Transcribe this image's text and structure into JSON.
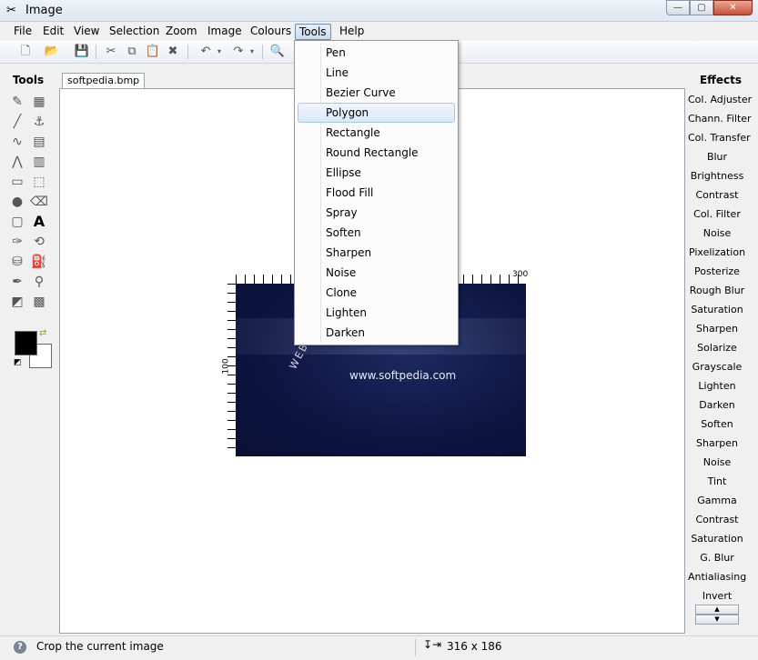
{
  "window": {
    "title": "Image",
    "min": "—",
    "max": "▢",
    "close": "✕"
  },
  "menu": [
    "File",
    "Edit",
    "View",
    "Selection",
    "Zoom",
    "Image",
    "Colours",
    "Tools",
    "Help"
  ],
  "tools_panel": {
    "title": "Tools"
  },
  "effects_panel": {
    "title": "Effects",
    "items": [
      "Col. Adjuster",
      "Chann. Filter",
      "Col. Transfer",
      "Blur",
      "Brightness",
      "Contrast",
      "Col. Filter",
      "Noise",
      "Pixelization",
      "Posterize",
      "Rough Blur",
      "Saturation",
      "Sharpen",
      "Solarize",
      "Grayscale",
      "Lighten",
      "Darken",
      "Soften",
      "Sharpen",
      "Noise",
      "Tint",
      "Gamma",
      "Contrast",
      "Saturation",
      "G. Blur",
      "Antialiasing",
      "Invert"
    ]
  },
  "document": {
    "tab": "softpedia.bmp",
    "ruler_top": "300",
    "ruler_left": "100",
    "image_text": "www.softpedia.com",
    "image_curve_text": "WEB ENTER"
  },
  "tools_menu": {
    "items": [
      "Pen",
      "Line",
      "Bezier Curve",
      "Polygon",
      "Rectangle",
      "Round Rectangle",
      "Ellipse",
      "Flood Fill",
      "Spray",
      "Soften",
      "Sharpen",
      "Noise",
      "Clone",
      "Lighten",
      "Darken"
    ],
    "highlighted": "Polygon"
  },
  "status": {
    "text": "Crop the current image",
    "dimensions": "316 x 186"
  }
}
